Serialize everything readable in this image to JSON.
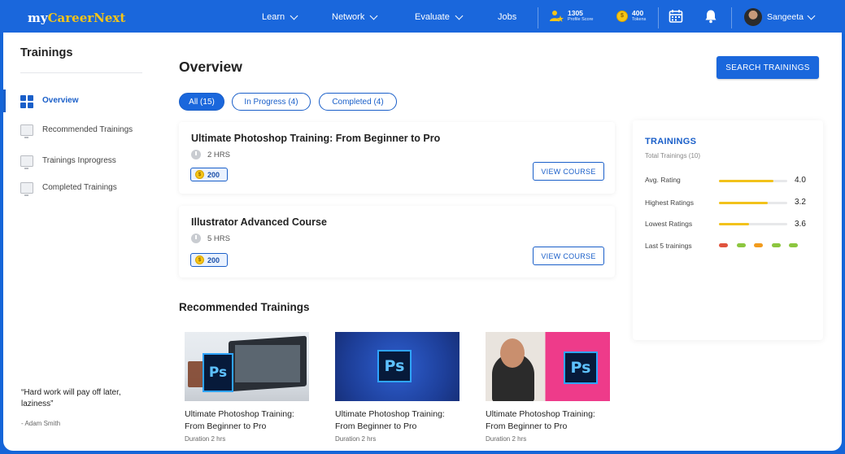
{
  "brand": {
    "prefix": "my",
    "name": "CareerNext"
  },
  "nav": {
    "items": [
      {
        "label": "Learn",
        "dropdown": true
      },
      {
        "label": "Network",
        "dropdown": true
      },
      {
        "label": "Evaluate",
        "dropdown": true
      },
      {
        "label": "Jobs",
        "dropdown": false
      }
    ],
    "profile_score": {
      "value": "1305",
      "label": "Profile Score"
    },
    "tokens": {
      "value": "400",
      "label": "Tokens"
    },
    "user": {
      "name": "Sangeeta"
    }
  },
  "sidebar": {
    "title": "Trainings",
    "items": [
      {
        "label": "Overview",
        "active": true
      },
      {
        "label": "Recommended Trainings",
        "active": false
      },
      {
        "label": "Trainings Inprogress",
        "active": false
      },
      {
        "label": "Completed Trainings",
        "active": false
      }
    ],
    "quote": "“Hard work will pay off later, laziness”",
    "quote_author": "- Adam Smith"
  },
  "main": {
    "title": "Overview",
    "search_button": "SEARCH TRAININGS",
    "filters": [
      {
        "label": "All (15)",
        "active": true
      },
      {
        "label": "In Progress (4)",
        "active": false
      },
      {
        "label": "Completed (4)",
        "active": false
      }
    ],
    "courses": [
      {
        "title": "Ultimate Photoshop Training: From Beginner to Pro",
        "duration": "2 HRS",
        "points": "200",
        "button": "VIEW COURSE"
      },
      {
        "title": "Illustrator Advanced Course",
        "duration": "5 HRS",
        "points": "200",
        "button": "VIEW COURSE"
      }
    ]
  },
  "stats": {
    "title": "TRAININGS",
    "subtitle": "Total Trainings (10)",
    "rows": [
      {
        "label": "Avg. Rating",
        "value": "4.0",
        "fill": 0.8
      },
      {
        "label": "Highest Ratings",
        "value": "3.2",
        "fill": 0.72
      },
      {
        "label": "Lowest Ratings",
        "value": "3.6",
        "fill": 0.44
      }
    ],
    "last5_label": "Last 5 trainings",
    "last5_colors": [
      "#e0533d",
      "#8cc63f",
      "#f29b1d",
      "#8cc63f",
      "#8cc63f"
    ]
  },
  "recommended": {
    "title": "Recommended Trainings",
    "cards": [
      {
        "title": "Ultimate Photoshop Training: From Beginner to Pro",
        "meta": "Duration 2 hrs"
      },
      {
        "title": "Ultimate Photoshop Training: From Beginner to Pro",
        "meta": "Duration 2 hrs"
      },
      {
        "title": "Ultimate Photoshop Training: From Beginner to Pro",
        "meta": "Duration 2 hrs"
      }
    ]
  },
  "colors": {
    "primary": "#1a67dc",
    "accent": "#f5c518",
    "rating_bar": "#f2c21b"
  }
}
